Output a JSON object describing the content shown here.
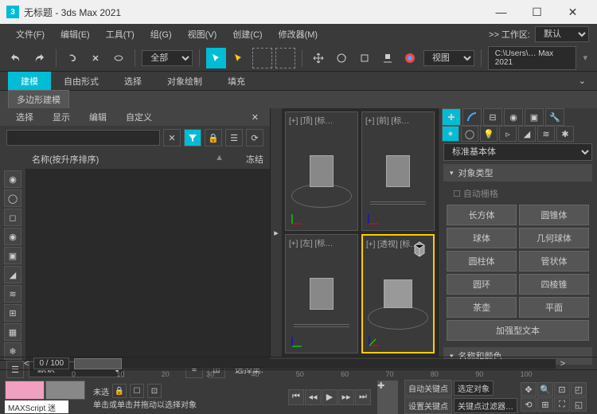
{
  "titlebar": {
    "title": "无标题 - 3ds Max 2021",
    "logo": "3"
  },
  "menubar": {
    "items": [
      "文件(F)",
      "编辑(E)",
      "工具(T)",
      "组(G)",
      "视图(V)",
      "创建(C)",
      "修改器(M)"
    ],
    "workspace_label": ">> 工作区:",
    "workspace_value": "默认"
  },
  "toolbar": {
    "scope": "全部",
    "view_label": "视图",
    "path": "C:\\Users\\… Max 2021"
  },
  "ribbon": {
    "tabs": [
      "建模",
      "自由形式",
      "选择",
      "对象绘制",
      "填充"
    ],
    "sub": "多边形建模"
  },
  "scene_panel": {
    "tabs": [
      "选择",
      "显示",
      "编辑",
      "自定义"
    ],
    "col_name": "名称(按升序排序)",
    "col_freeze": "冻结",
    "layer_default": "默认",
    "selset_label": "选择集:"
  },
  "viewports": {
    "v0": "[+] [顶] [标…",
    "v1": "[+] [前] [标…",
    "v2": "[+] [左] [标…",
    "v3": "[+] [透视] [标…"
  },
  "cmd_panel": {
    "category": "标准基本体",
    "rollout_objtype": "对象类型",
    "autogrid": "自动栅格",
    "objects": [
      "长方体",
      "圆锥体",
      "球体",
      "几何球体",
      "圆柱体",
      "管状体",
      "圆环",
      "四棱锥",
      "茶壶",
      "平面",
      "加强型文本"
    ],
    "rollout_namecolor": "名称和颜色"
  },
  "timeline": {
    "frame": "0 / 100",
    "ticks": [
      "0",
      "10",
      "20",
      "30",
      "40",
      "50",
      "60",
      "70",
      "80",
      "90",
      "100"
    ]
  },
  "status": {
    "script": "MAXScript 迷",
    "unselected": "未选",
    "hint": "单击或单击并拖动以选择对象",
    "autokey": "自动关键点",
    "setkey": "设置关键点",
    "selobj": "选定对象",
    "keyfilter": "关键点过滤器…"
  }
}
